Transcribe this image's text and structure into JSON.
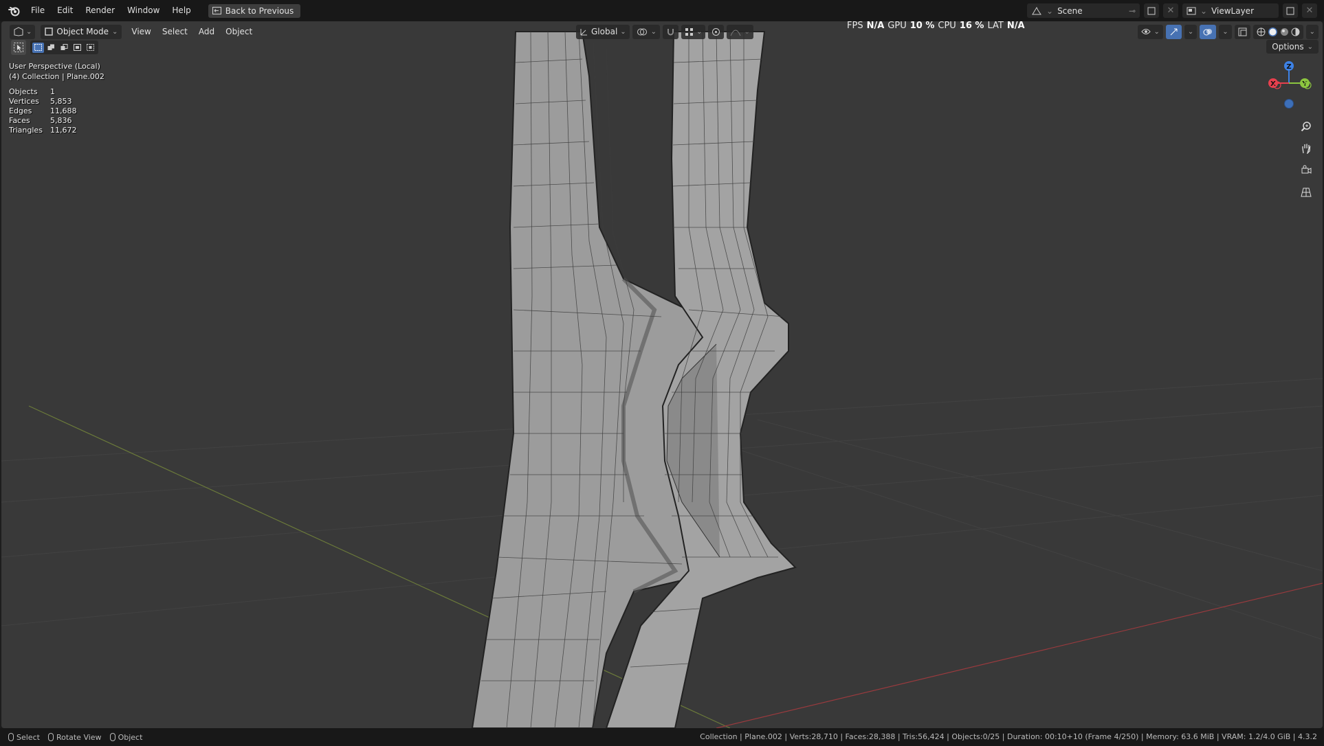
{
  "topbar": {
    "menus": [
      "File",
      "Edit",
      "Render",
      "Window",
      "Help"
    ],
    "back_button": "Back to Previous",
    "scene_name": "Scene",
    "view_layer": "ViewLayer"
  },
  "viewport_header": {
    "editor_icon": "3d-viewport-icon",
    "mode": "Object Mode",
    "menus": [
      "View",
      "Select",
      "Add",
      "Object"
    ],
    "transform_orientation": "Global"
  },
  "perf_stats": {
    "fps_label": "FPS",
    "fps_value": "N/A",
    "gpu_label": "GPU",
    "gpu_value": "10 %",
    "cpu_label": "CPU",
    "cpu_value": "16 %",
    "lat_label": "LAT",
    "lat_value": "N/A"
  },
  "options_label": "Options",
  "overlay_info": {
    "view_name": "User Perspective (Local)",
    "collection": "(4) Collection | Plane.002",
    "stats": [
      {
        "label": "Objects",
        "value": "1"
      },
      {
        "label": "Vertices",
        "value": "5,853"
      },
      {
        "label": "Edges",
        "value": "11,688"
      },
      {
        "label": "Faces",
        "value": "5,836"
      },
      {
        "label": "Triangles",
        "value": "11,672"
      }
    ]
  },
  "gizmo": {
    "x": "X",
    "y": "Y",
    "z": "Z"
  },
  "statusbar": {
    "select": "Select",
    "rotate": "Rotate View",
    "object": "Object",
    "info": "Collection | Plane.002 | Verts:28,710 | Faces:28,388 | Tris:56,424 | Objects:0/25 | Duration: 00:10+10 (Frame 4/250) | Memory: 63.6 MiB | VRAM: 1.2/4.0 GiB | 4.3.2"
  },
  "colors": {
    "accent": "#4772b3",
    "axis_x": "#e8404e",
    "axis_y": "#8cc63f",
    "axis_z": "#3d82e6",
    "viewport_bg": "#393939"
  }
}
